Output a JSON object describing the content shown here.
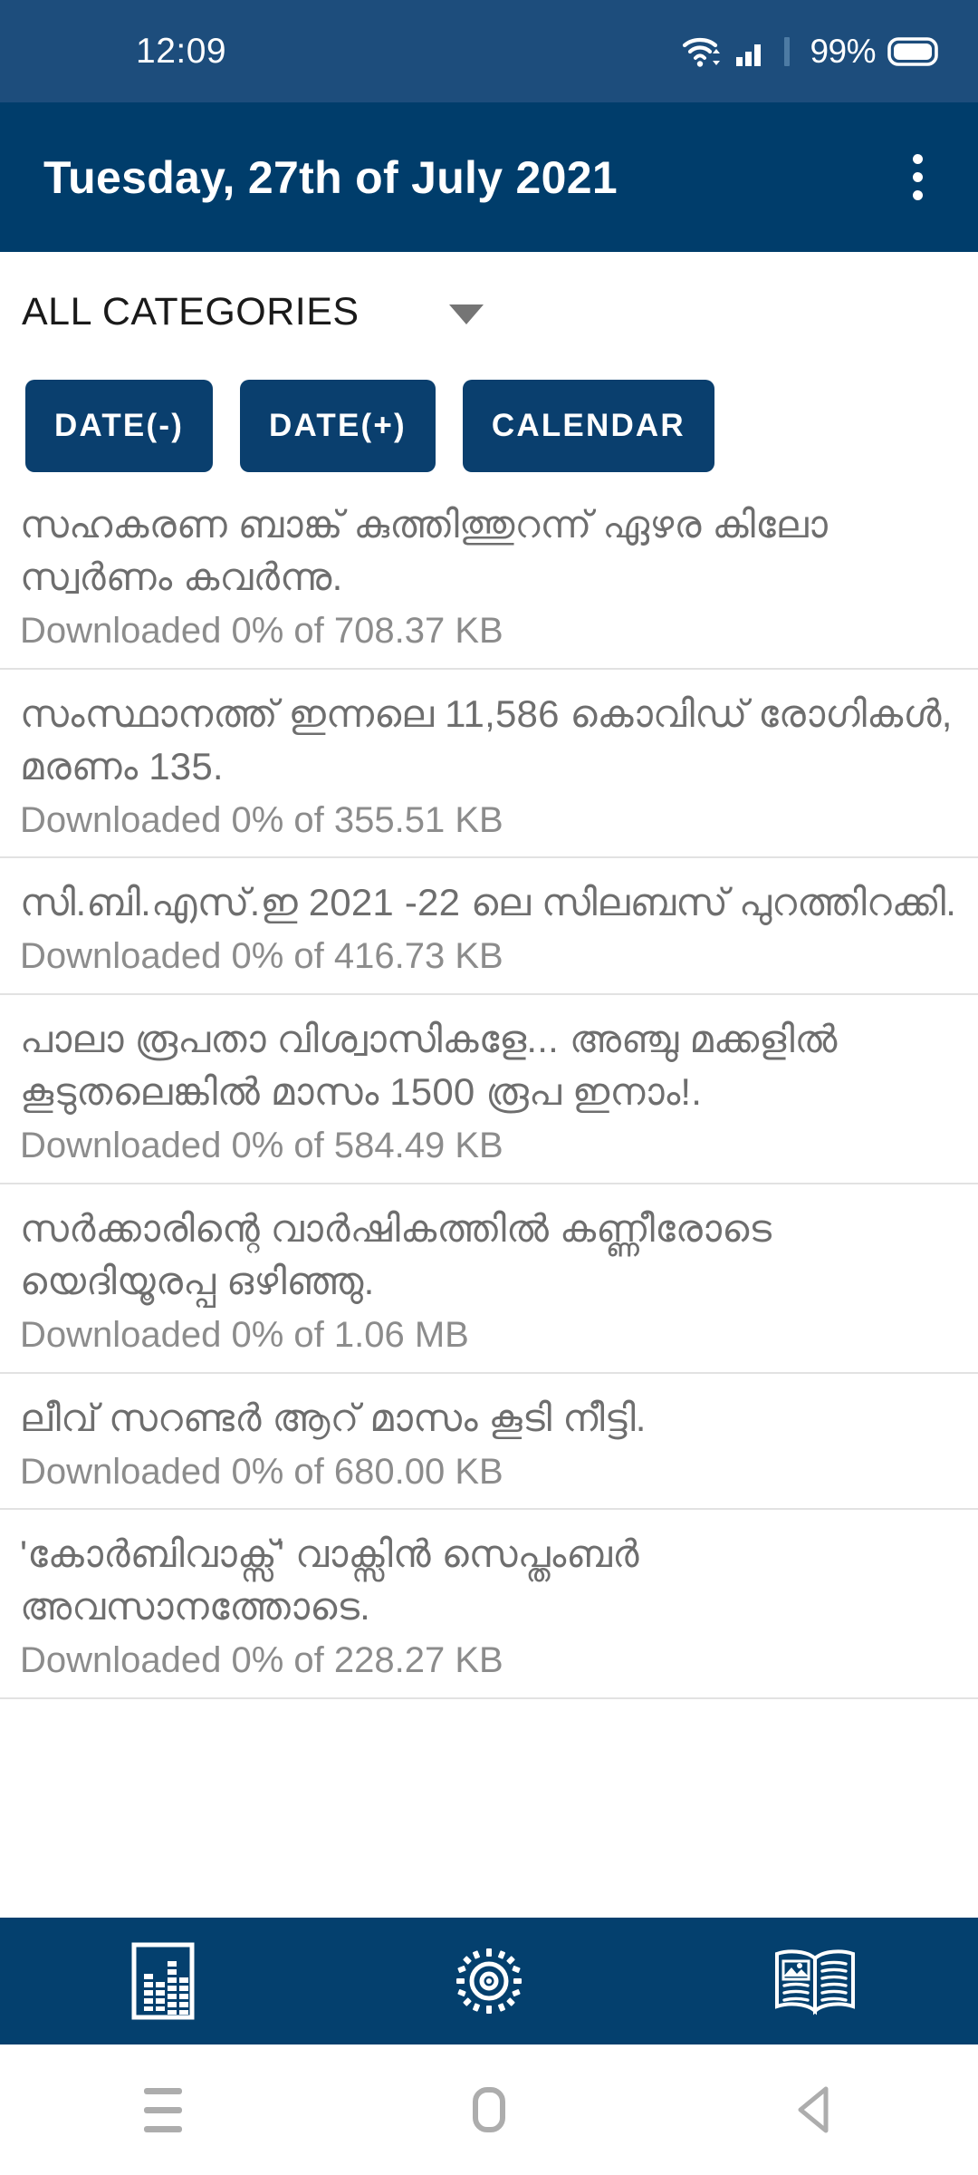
{
  "status_bar": {
    "clock": "12:09",
    "battery_percent": "99%",
    "wifi_icon": "wifi-icon",
    "signal_icon": "signal-bars-icon",
    "battery_icon": "battery-icon",
    "background_color": "#1d4d7c"
  },
  "app_bar": {
    "title": "Tuesday, 27th of July 2021",
    "overflow_icon": "more-vertical-icon",
    "background_color": "#003d6b"
  },
  "category_selector": {
    "selected": "ALL CATEGORIES",
    "caret_icon": "caret-down-icon"
  },
  "toolbar": {
    "date_prev_label": "DATE(-)",
    "date_next_label": "DATE(+)",
    "calendar_label": "CALENDAR",
    "button_color": "#0a3f6e"
  },
  "news": {
    "items": [
      {
        "headline": "സഹകരണ ബാങ്ക് കുത്തിത്തുറന്ന്  ഏഴര കിലോ സ്വർണം കവർന്നു.",
        "status": "Downloaded 0% of 708.37 KB"
      },
      {
        "headline": "സംസ്ഥാനത്ത് ഇന്നലെ 11,586 കൊവിഡ് രോഗികൾ, മരണം 135.",
        "status": "Downloaded 0% of 355.51 KB"
      },
      {
        "headline": "സി.ബി.എസ്.ഇ  2021 -22 ലെ സിലബസ് പുറത്തിറക്കി.",
        "status": "Downloaded 0% of 416.73 KB"
      },
      {
        "headline": "പാലാ രൂപതാ വിശ്വാസികളേ... അഞ്ചു മക്കളിൽ കൂടുതലെങ്കിൽ മാസം 1500 രൂപ ഇനാം!.",
        "status": "Downloaded 0% of 584.49 KB"
      },
      {
        "headline": "സർക്കാരിന്റെ വാർഷികത്തിൽ കണ്ണീരോടെ യെദിയൂരപ്പ ഒഴിഞ്ഞു.",
        "status": "Downloaded 0% of 1.06 MB"
      },
      {
        "headline": "ലീവ് സറണ്ടർ ആറ് മാസം കൂടി നീട്ടി.",
        "status": "Downloaded 0% of 680.00 KB"
      },
      {
        "headline": "'കോർബിവാക്സ്' വാക്സിൻ  സെപ്തംബർ അവസാനത്തോടെ.",
        "status": "Downloaded 0% of 228.27 KB"
      }
    ]
  },
  "bottom_nav": {
    "background_color": "#04406e",
    "items": [
      {
        "icon": "chart-newspaper-icon",
        "label": ""
      },
      {
        "icon": "radial-settings-icon",
        "label": ""
      },
      {
        "icon": "open-book-icon",
        "label": ""
      }
    ]
  },
  "system_nav": {
    "recents_icon": "menu-icon",
    "home_icon": "home-icon",
    "back_icon": "back-triangle-icon"
  }
}
